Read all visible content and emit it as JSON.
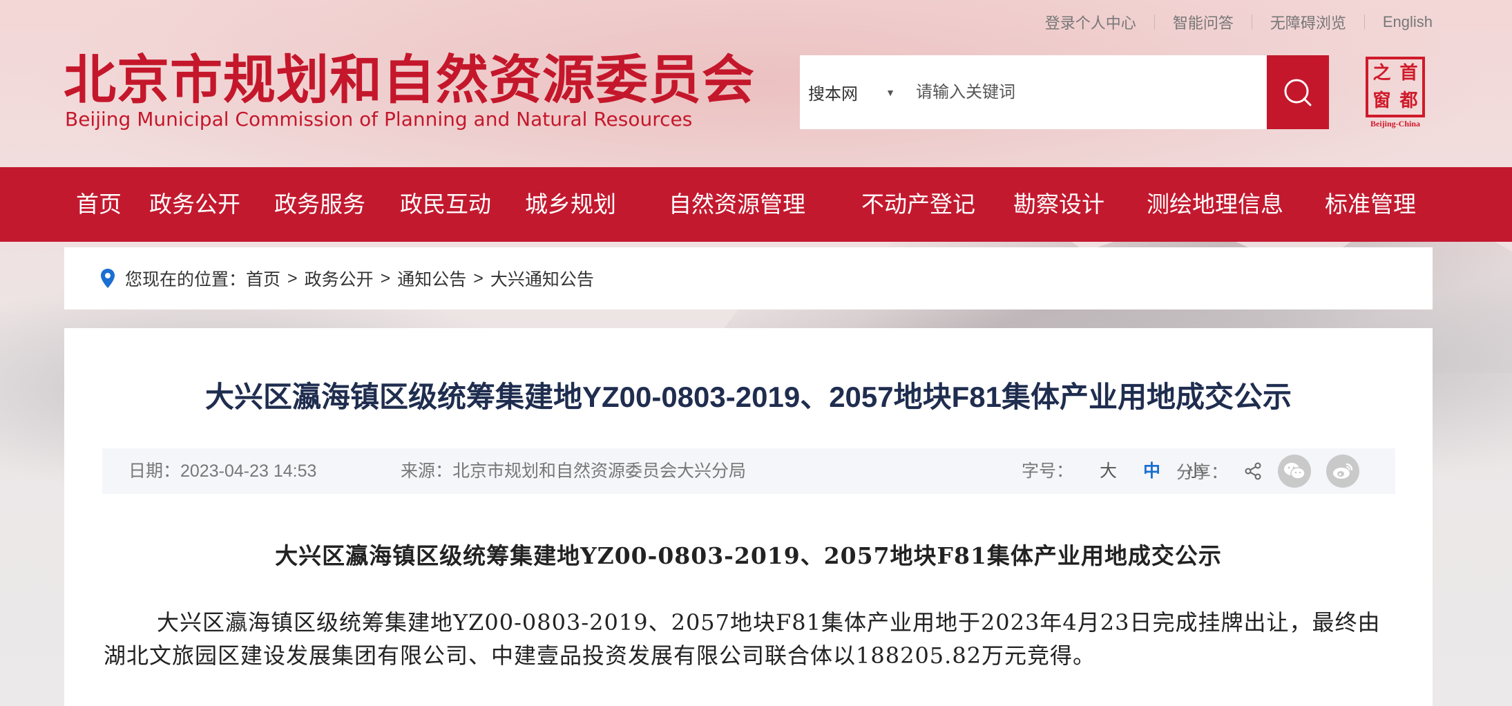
{
  "top_links": [
    "登录个人中心",
    "智能问答",
    "无障碍浏览",
    "English"
  ],
  "logo": {
    "cn": "北京市规划和自然资源委员会",
    "en": "Beijing Municipal Commission of Planning and Natural Resources"
  },
  "search": {
    "scope": "搜本网",
    "placeholder": "请输入关键词"
  },
  "emblem": {
    "chars": [
      "首",
      "都",
      "之",
      "窗"
    ],
    "caption": "Beijing-China"
  },
  "nav": [
    "首页",
    "政务公开",
    "政务服务",
    "政民互动",
    "城乡规划",
    "自然资源管理",
    "不动产登记",
    "勘察设计",
    "测绘地理信息",
    "标准管理"
  ],
  "breadcrumb": {
    "label": "您现在的位置：",
    "items": [
      "首页",
      "政务公开",
      "通知公告",
      "大兴通知公告"
    ]
  },
  "article": {
    "title": "大兴区瀛海镇区级统筹集建地YZ00-0803-2019、2057地块F81集体产业用地成交公示",
    "date": "日期：2023-04-23 14:53",
    "source": "来源：北京市规划和自然资源委员会大兴分局",
    "font_size_label": "字号：",
    "font_sizes": [
      "大",
      "中",
      "小"
    ],
    "share_label": "分享：",
    "content_title": "大兴区瀛海镇区级统筹集建地YZ00-0803-2019、2057地块F81集体产业用地成交公示",
    "content_body": "大兴区瀛海镇区级统筹集建地YZ00-0803-2019、2057地块F81集体产业用地于2023年4月23日完成挂牌出让，最终由湖北文旅园区建设发展集团有限公司、中建壹品投资发展有限公司联合体以188205.82万元竞得。"
  },
  "colors": {
    "brand_red": "#c3192f",
    "title_navy": "#1f2d4f",
    "active_blue": "#1a6fd1"
  },
  "icons": [
    "search-icon",
    "location-pin-icon",
    "share-icon",
    "wechat-icon",
    "weibo-icon"
  ]
}
